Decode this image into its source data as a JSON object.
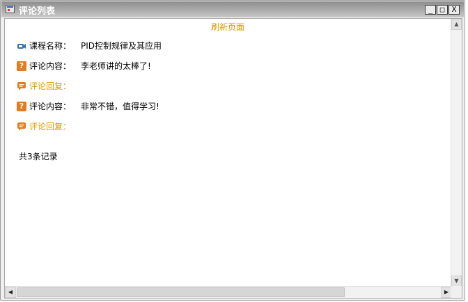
{
  "window": {
    "title": "评论列表",
    "controls": {
      "minimize": "_",
      "maximize": "□",
      "close": "X"
    }
  },
  "header": {
    "refresh_link": "刷新页面"
  },
  "course": {
    "label": "课程名称：",
    "value": "PID控制规律及其应用",
    "icon": "video-camera-icon"
  },
  "comments": [
    {
      "label": "评论内容：",
      "value": "李老师讲的太棒了!",
      "icon": "question-icon",
      "reply_label": "评论回复：",
      "reply_icon": "chat-bubble-icon"
    },
    {
      "label": "评论内容：",
      "value": "非常不错，值得学习!",
      "icon": "question-icon",
      "reply_label": "评论回复：",
      "reply_icon": "chat-bubble-icon"
    }
  ],
  "footer": {
    "total_text": "共3条记录"
  },
  "colors": {
    "accent_orange": "#d99a00",
    "icon_orange": "#e37b1f",
    "icon_blue": "#2f6fb5"
  }
}
